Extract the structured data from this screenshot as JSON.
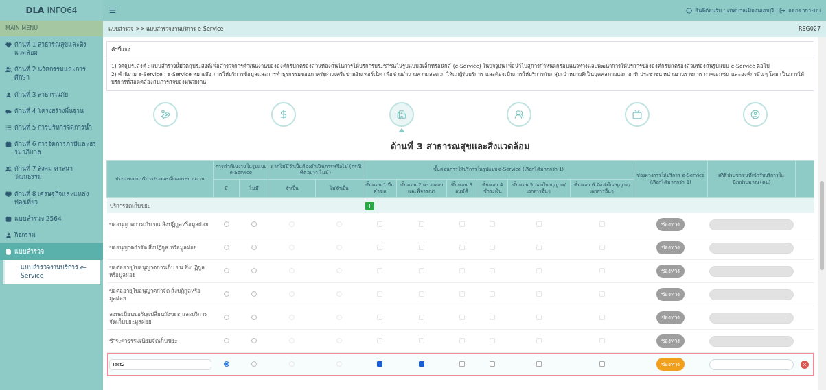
{
  "brand": {
    "bold": "DLA",
    "light": "INFO64"
  },
  "header": {
    "welcome": "ยินดีต้อนรับ : เทศบาลเมืองนนทบุรี",
    "logout": "ออกจากระบบ"
  },
  "sidebar": {
    "heading": "MAIN MENU",
    "items": [
      {
        "label": "ด้านที่ 1 สาธารณสุขและสิ่งแวดล้อม",
        "selected": false
      },
      {
        "label": "ด้านที่ 2 นวัตกรรมและการศึกษา",
        "selected": false
      },
      {
        "label": "ด้านที่ 3 สาธารณภัย",
        "selected": false
      },
      {
        "label": "ด้านที่ 4 โครงสร้างพื้นฐาน",
        "selected": false
      },
      {
        "label": "ด้านที่ 5 การบริหารจัดการน้ำ",
        "selected": false
      },
      {
        "label": "ด้านที่ 6 การจัดการภาษีและธรรมาภิบาล",
        "selected": false
      },
      {
        "label": "ด้านที่ 7 สังคม ศาสนา วัฒนธรรม",
        "selected": false
      },
      {
        "label": "ด้านที่ 8 เศรษฐกิจและแหล่งท่องเที่ยว",
        "selected": false
      },
      {
        "label": "แบบสำรวจ 2564",
        "selected": false
      },
      {
        "label": "กิจกรรม",
        "selected": false
      },
      {
        "label": "แบบสำรวจ",
        "selected": true,
        "children": [
          {
            "label": "แบบสำรวจงานบริการ e-Service",
            "selected": true
          }
        ]
      }
    ]
  },
  "breadcrumb": {
    "path": "แบบสำรวจ >> แบบสำรวจงานบริการ e-Service",
    "code": "REG027"
  },
  "instructions": {
    "title": "คำชี้แจง",
    "lines": [
      "1) วัตถุประสงค์ : แบบสำรวจนี้มีวัตถุประสงค์เพื่อสำรวจการดำเนินงานขององค์กรปกครองส่วนท้องถิ่นในการให้บริการประชาชนในรูปแบบอิเล็กทรอนิกส์ (e-Service) ในปัจจุบัน เพื่อนำไปสู่การกำหนดกรอบแนวทางและพัฒนาการให้บริการขององค์กรปกครองส่วนท้องถิ่นรูปแบบ e-Service ต่อไป",
      "2) คำนิยาม e-Service : e-Service หมายถึง การให้บริการข้อมูลและการทำธุรกรรมของภาครัฐผ่านเครือข่ายอินเทอร์เน็ต เพื่อช่วยอำนวยความสะดวก ให้แก่ผู้รับบริการ และต้องเป็นการให้บริการกับกลุ่มเป้าหมายที่เป็นบุคคลภายนอก อาทิ ประชาชน หน่วยงานราชการ ภาคเอกชน และองค์กรอื่น ๆ โดย เป็นการให้บริการที่สอดคล้องกับภารกิจของหน่วยงาน"
    ]
  },
  "categories": [
    {
      "selected": false
    },
    {
      "selected": false
    },
    {
      "selected": true
    },
    {
      "selected": false
    },
    {
      "selected": false
    },
    {
      "selected": false
    }
  ],
  "section_title": "ด้านที่ 3 สาธารณสุขและสิ่งแวดล้อม",
  "table": {
    "columns": {
      "name": "ประเภทงานบริการ/รายละเอียดกระบวนงาน",
      "eservice": "การดำเนินงานในรูปแบบ e-Service",
      "eservice_options": [
        "มี",
        "ไม่มี"
      ],
      "need": "หากไม่มีจำเป็นต้องดำเนินการหรือไม่ (กรณีที่ตอบว่า ไม่มี)",
      "need_options": [
        "จำเป็น",
        "ไม่จำเป็น"
      ],
      "steps": "ขั้นตอนการให้บริการในรูปแบบ e-Service (เลือกได้มากกว่า 1)",
      "step_options": [
        "ขั้นตอน 1 ยื่นคำขอ",
        "ขั้นตอน 2 ตรวจสอบและพิจารณา",
        "ขั้นตอน 3 อนุมัติ",
        "ขั้นตอน 4 ชำระเงิน",
        "ขั้นตอน 5 ออกใบอนุญาต/เอกสารอื่นๆ",
        "ขั้นตอน 6 จัดส่งใบอนุญาต/เอกสารอื่นๆ"
      ],
      "channel": "ช่องทางการให้บริการ e-Service (เลือกได้มากกว่า 1)",
      "statistic": "สถิติประชาชนที่เข้ารับบริการในปีงบประมาณ (คน)"
    },
    "group": "บริการจัดเก็บขยะ",
    "rows": [
      {
        "kind": "item",
        "name": "ขออนุญาตการเก็บ ขน สิ่งปฏิกูลหรือมูลฝอย",
        "eservice": [
          {
            "selected": false
          },
          {
            "selected": false
          }
        ],
        "need": [
          {
            "selected": false
          },
          {
            "selected": false
          }
        ],
        "need_disabled": true,
        "steps": [
          {
            "checked": false
          },
          {
            "checked": false
          },
          {
            "checked": false
          },
          {
            "checked": false
          },
          {
            "checked": false
          },
          {
            "checked": false
          }
        ],
        "steps_disabled": true,
        "channel": {
          "label": "ช่องทาง",
          "disabled": true
        },
        "statistic_disabled": true
      },
      {
        "kind": "item",
        "name": "ขออนุญาตกำจัด สิ่งปฏิกูล หรือมูลฝอย",
        "eservice": [
          {
            "selected": false
          },
          {
            "selected": false
          }
        ],
        "need": [
          {
            "selected": false
          },
          {
            "selected": false
          }
        ],
        "need_disabled": true,
        "steps": [
          {
            "checked": false
          },
          {
            "checked": false
          },
          {
            "checked": false
          },
          {
            "checked": false
          },
          {
            "checked": false
          },
          {
            "checked": false
          }
        ],
        "steps_disabled": true,
        "channel": {
          "label": "ช่องทาง",
          "disabled": true
        },
        "statistic_disabled": true
      },
      {
        "kind": "item",
        "name": "ขอต่ออายุใบอนุญาตการเก็บ ขน สิ่งปฏิกูลหรือมูลฝอย",
        "eservice": [
          {
            "selected": false
          },
          {
            "selected": false
          }
        ],
        "need": [
          {
            "selected": false
          },
          {
            "selected": false
          }
        ],
        "need_disabled": true,
        "steps": [
          {
            "checked": false
          },
          {
            "checked": false
          },
          {
            "checked": false
          },
          {
            "checked": false
          },
          {
            "checked": false
          },
          {
            "checked": false
          }
        ],
        "steps_disabled": true,
        "channel": {
          "label": "ช่องทาง",
          "disabled": true
        },
        "statistic_disabled": true
      },
      {
        "kind": "item",
        "name": "ขอต่ออายุใบอนุญาตกำจัด สิ่งปฏิกูลหรือมูลฝอย",
        "eservice": [
          {
            "selected": false
          },
          {
            "selected": false
          }
        ],
        "need": [
          {
            "selected": false
          },
          {
            "selected": false
          }
        ],
        "need_disabled": true,
        "steps": [
          {
            "checked": false
          },
          {
            "checked": false
          },
          {
            "checked": false
          },
          {
            "checked": false
          },
          {
            "checked": false
          },
          {
            "checked": false
          }
        ],
        "steps_disabled": true,
        "channel": {
          "label": "ช่องทาง",
          "disabled": true
        },
        "statistic_disabled": true
      },
      {
        "kind": "item",
        "name": "ลงทะเบียนขอรับ/เปลี่ยนถังขยะ และบริการจัดเก็บขยะมูลฝอย",
        "eservice": [
          {
            "selected": false
          },
          {
            "selected": false
          }
        ],
        "need": [
          {
            "selected": false
          },
          {
            "selected": false
          }
        ],
        "need_disabled": true,
        "steps": [
          {
            "checked": false
          },
          {
            "checked": false
          },
          {
            "checked": false
          },
          {
            "checked": false
          },
          {
            "checked": false
          },
          {
            "checked": false
          }
        ],
        "steps_disabled": true,
        "channel": {
          "label": "ช่องทาง",
          "disabled": true
        },
        "statistic_disabled": true
      },
      {
        "kind": "item",
        "name": "ชำระค่าธรรมเนียมจัดเก็บขยะ",
        "eservice": [
          {
            "selected": false
          },
          {
            "selected": false
          }
        ],
        "need": [
          {
            "selected": false
          },
          {
            "selected": false
          }
        ],
        "need_disabled": true,
        "steps": [
          {
            "checked": false
          },
          {
            "checked": false
          },
          {
            "checked": false
          },
          {
            "checked": false
          },
          {
            "checked": false
          },
          {
            "checked": false
          }
        ],
        "steps_disabled": true,
        "channel": {
          "label": "ช่องทาง",
          "disabled": true
        },
        "statistic_disabled": true
      },
      {
        "kind": "custom",
        "name": "Test2",
        "eservice": [
          {
            "selected": true
          },
          {
            "selected": false
          }
        ],
        "need": [
          {
            "selected": false
          },
          {
            "selected": false
          }
        ],
        "need_disabled": true,
        "steps": [
          {
            "checked": true
          },
          {
            "checked": true
          },
          {
            "checked": false
          },
          {
            "checked": false
          },
          {
            "checked": false
          },
          {
            "checked": false
          }
        ],
        "steps_disabled": false,
        "channel": {
          "label": "ช่องทาง",
          "disabled": false
        },
        "statistic_disabled": false
      }
    ]
  }
}
